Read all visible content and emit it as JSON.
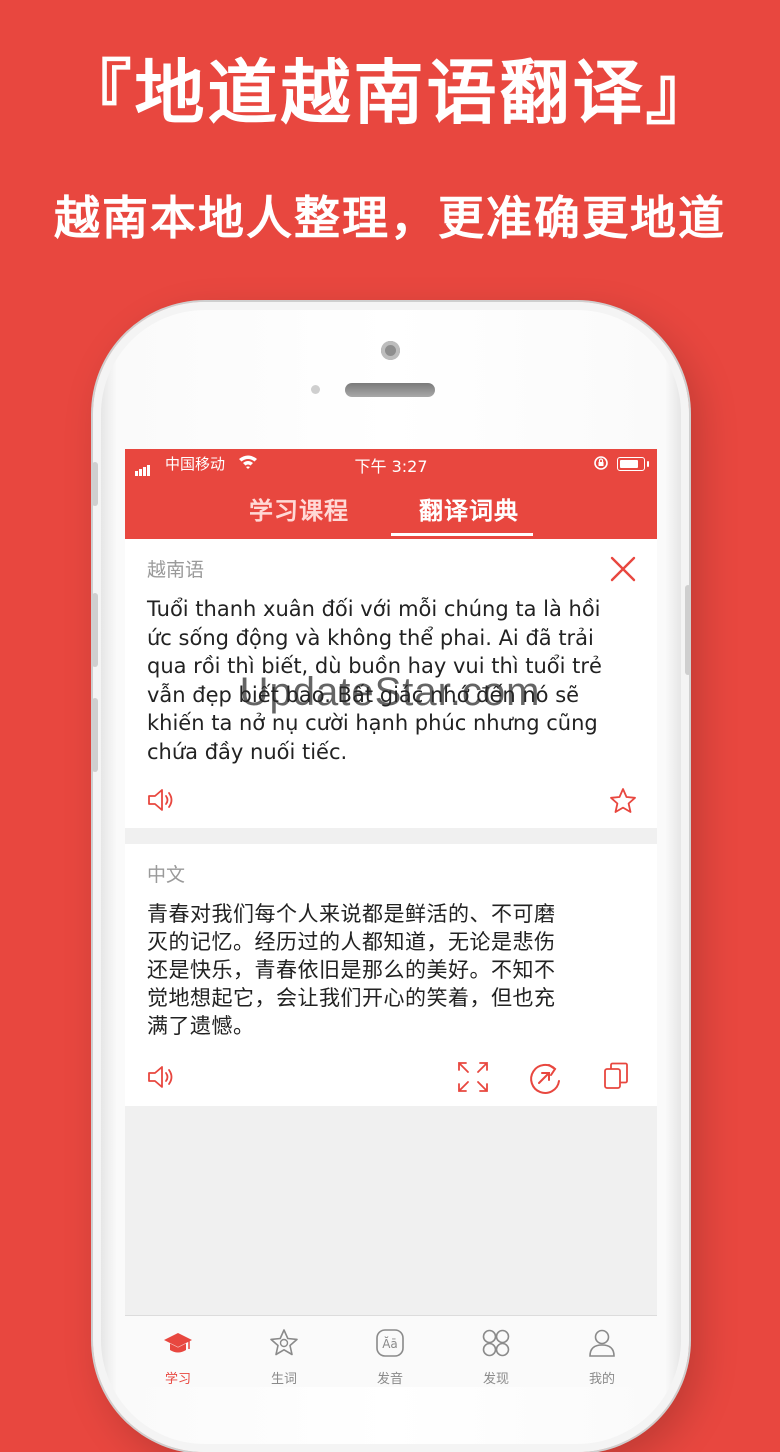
{
  "promo": {
    "title": "『地道越南语翻译』",
    "subtitle": "越南本地人整理，更准确更地道"
  },
  "status_bar": {
    "carrier": "中国移动",
    "time": "下午 3:27"
  },
  "top_tabs": [
    {
      "label": "学习课程",
      "active": false
    },
    {
      "label": "翻译词典",
      "active": true
    }
  ],
  "source_card": {
    "label": "越南语",
    "lines": [
      "Tuổi thanh xuân đối với mỗi chúng ta là hồi",
      "ức sống động và không thể phai. Ai đã trải",
      "qua rồi thì biết, dù buồn hay vui thì tuổi trẻ",
      "vẫn đẹp biết bao. Bất giác nhớ đến nó sẽ",
      "khiến ta nở nụ cười hạnh phúc nhưng cũng",
      "chứa đầy nuối tiếc."
    ],
    "icons": [
      "close-icon",
      "speaker-icon",
      "star-icon"
    ]
  },
  "target_card": {
    "label": "中文",
    "lines": [
      "青春对我们每个人来说都是鲜活的、不可磨",
      "灭的记忆。经历过的人都知道，无论是悲伤",
      "还是快乐，青春依旧是那么的美好。不知不",
      "觉地想起它，会让我们开心的笑着，但也充",
      "满了遗憾。"
    ],
    "icons": [
      "speaker-icon",
      "fullscreen-icon",
      "share-icon",
      "copy-icon"
    ]
  },
  "tab_bar": [
    {
      "label": "学习",
      "icon": "graduation-cap-icon",
      "active": true
    },
    {
      "label": "生词",
      "icon": "star-badge-icon",
      "active": false
    },
    {
      "label": "发音",
      "icon": "pronunciation-icon",
      "icon_text": "Ăā",
      "active": false
    },
    {
      "label": "发现",
      "icon": "grid-icon",
      "active": false
    },
    {
      "label": "我的",
      "icon": "user-icon",
      "active": false
    }
  ],
  "watermark": "UpdateStar.com",
  "colors": {
    "accent": "#e8473f",
    "card_bg": "#ffffff",
    "screen_bg": "#f0f0f0"
  }
}
